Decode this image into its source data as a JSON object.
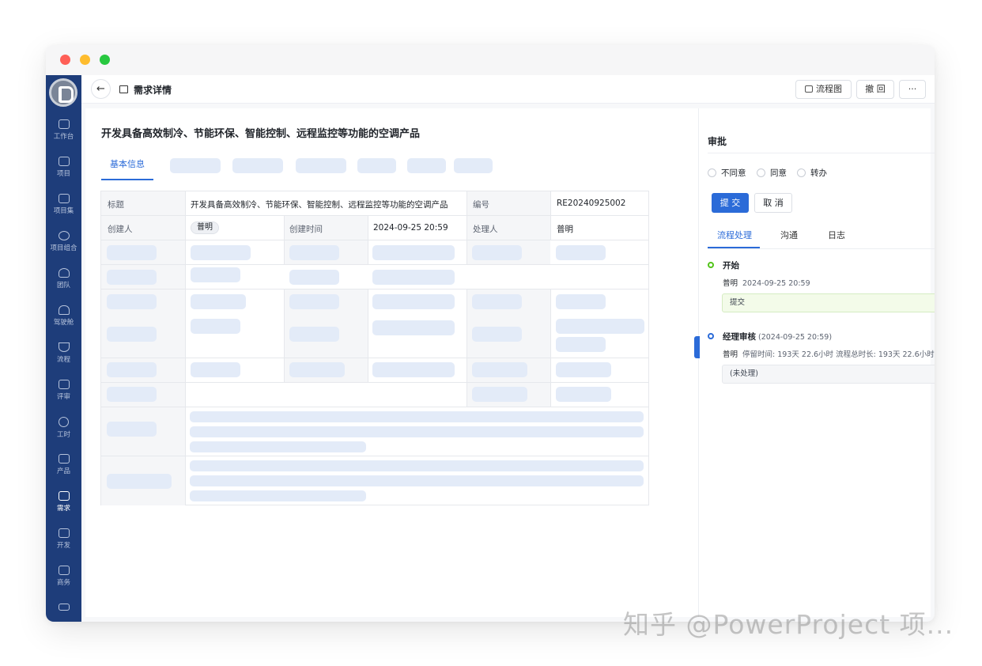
{
  "sidebar": {
    "items": [
      {
        "label": "工作台",
        "icon": "home-icon"
      },
      {
        "label": "项目",
        "icon": "project-icon"
      },
      {
        "label": "项目集",
        "icon": "program-icon"
      },
      {
        "label": "项目组合",
        "icon": "portfolio-icon"
      },
      {
        "label": "团队",
        "icon": "team-icon"
      },
      {
        "label": "驾驶舱",
        "icon": "cockpit-icon"
      },
      {
        "label": "流程",
        "icon": "flow-icon"
      },
      {
        "label": "评审",
        "icon": "review-icon"
      },
      {
        "label": "工时",
        "icon": "clock-icon"
      },
      {
        "label": "产品",
        "icon": "product-icon"
      },
      {
        "label": "需求",
        "icon": "requirement-icon"
      },
      {
        "label": "开发",
        "icon": "terminal-icon"
      },
      {
        "label": "商务",
        "icon": "business-icon"
      }
    ]
  },
  "header": {
    "back_icon": "←",
    "page_title": "需求详情",
    "flowchart_label": "流程图",
    "withdraw_label": "撤 回",
    "more_label": "···"
  },
  "main": {
    "title": "开发具备高效制冷、节能环保、智能控制、远程监控等功能的空调产品",
    "active_tab": "基本信息",
    "info": {
      "title_label": "标题",
      "title_value": "开发具备高效制冷、节能环保、智能控制、远程监控等功能的空调产品",
      "number_label": "编号",
      "number_value": "RE20240925002",
      "creator_label": "创建人",
      "creator_value": "普明",
      "created_time_label": "创建时间",
      "created_time_value": "2024-09-25 20:59",
      "handler_label": "处理人",
      "handler_value": "普明"
    }
  },
  "approval": {
    "title": "审批",
    "options": [
      "不同意",
      "同意",
      "转办"
    ],
    "submit_label": "提 交",
    "cancel_label": "取 消",
    "tabs": [
      "流程处理",
      "沟通",
      "日志"
    ],
    "timeline": {
      "start": {
        "name": "开始",
        "user": "普明",
        "time": "2024-09-25 20:59",
        "note": "提交"
      },
      "review": {
        "name": "经理审核",
        "time": "(2024-09-25 20:59)",
        "user": "普明",
        "stay_label": "停留时间:",
        "stay_value": "193天 22.6小时",
        "total_label": "流程总时长:",
        "total_value": "193天 22.6小时",
        "note": "(未处理)"
      }
    }
  },
  "watermark": "知乎 @PowerProject 项...",
  "colors": {
    "sidebar": "#1e3d7a",
    "accent": "#2b6bd8",
    "skeleton": "#e3ebf8",
    "timeline_green": "#52c41a"
  }
}
